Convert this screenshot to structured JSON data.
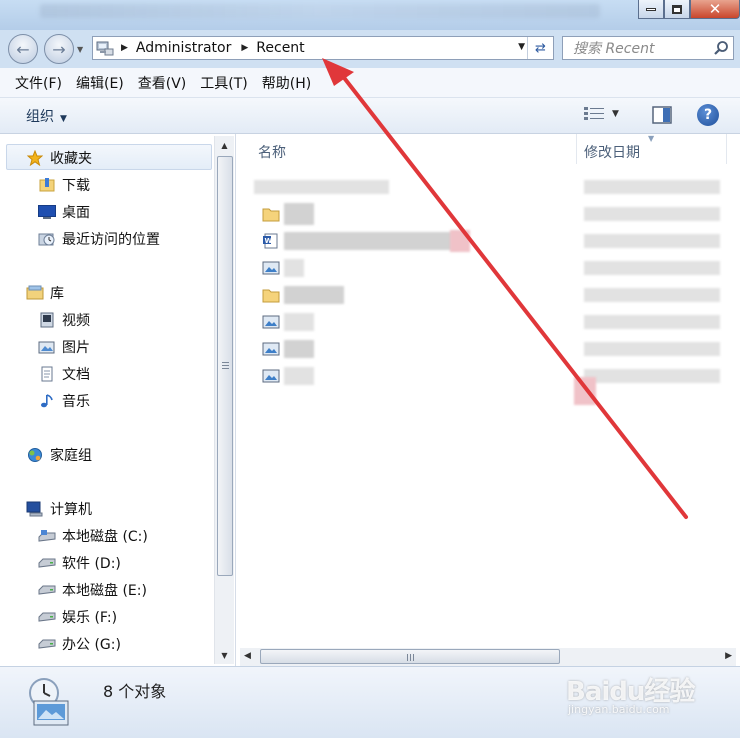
{
  "window": {
    "minimize_glyph": "",
    "maximize_glyph": "",
    "close_glyph": "✕"
  },
  "address": {
    "crumbs": [
      "Administrator",
      "Recent"
    ],
    "search_placeholder": "搜索 Recent"
  },
  "menu": [
    "文件(F)",
    "编辑(E)",
    "查看(V)",
    "工具(T)",
    "帮助(H)"
  ],
  "toolbar": {
    "organize_label": "组织",
    "help_label": "?"
  },
  "nav": {
    "favorites": {
      "label": "收藏夹",
      "items": [
        "下载",
        "桌面",
        "最近访问的位置"
      ]
    },
    "libraries": {
      "label": "库",
      "items": [
        "视频",
        "图片",
        "文档",
        "音乐"
      ]
    },
    "homegroup": {
      "label": "家庭组"
    },
    "computer": {
      "label": "计算机",
      "items": [
        "本地磁盘 (C:)",
        "软件 (D:)",
        "本地磁盘 (E:)",
        "娱乐 (F:)",
        "办公 (G:)"
      ]
    }
  },
  "columns": {
    "name": "名称",
    "date_modified": "修改日期"
  },
  "files": [
    {
      "icon": "network-icon"
    },
    {
      "icon": "folder-icon"
    },
    {
      "icon": "word-doc-icon"
    },
    {
      "icon": "image-file-icon"
    },
    {
      "icon": "folder-icon"
    },
    {
      "icon": "image-file-icon"
    },
    {
      "icon": "image-file-icon"
    },
    {
      "icon": "image-file-icon"
    }
  ],
  "status": {
    "count_text": "8 个对象"
  },
  "watermark": {
    "brand": "Baidu经验",
    "sub": "jingyan.baidu.com"
  },
  "colors": {
    "annotation_arrow": "#e0373a",
    "accent": "#1f4f9b"
  }
}
